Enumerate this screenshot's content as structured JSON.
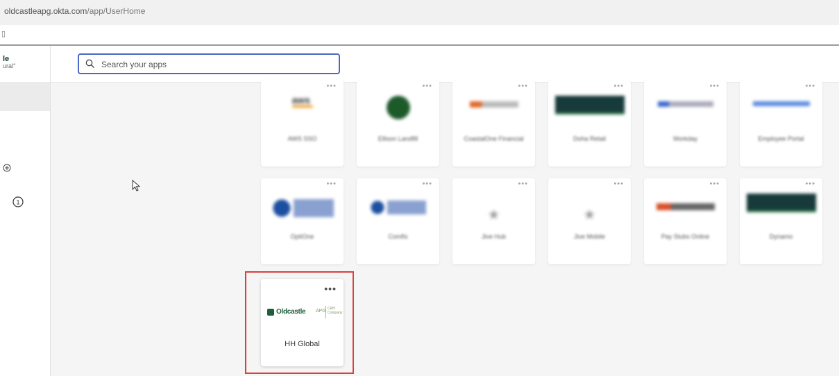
{
  "browser": {
    "url_host": "oldcastleapg.okta.com",
    "url_path": "/app/UserHome"
  },
  "sidebar": {
    "logo_line1": "le",
    "logo_line2": "ural°",
    "icons": [
      "plus-circle-icon",
      "info-circle-icon"
    ],
    "info_count": "1"
  },
  "search": {
    "placeholder": "Search your apps",
    "value": ""
  },
  "blurred_tiles_row1": [
    {
      "label": "AWS SSO",
      "logo": "aws",
      "color": "#f08c00"
    },
    {
      "label": "Ellison Landfill",
      "logo": "green-circle",
      "color": "#1d5a2a"
    },
    {
      "label": "CoastalOne Financial",
      "logo": "orange-bar",
      "color": "#e06b2a"
    },
    {
      "label": "Doha Retail",
      "logo": "dark-banner",
      "color": "#173a3a"
    },
    {
      "label": "Workday",
      "logo": "blue-text",
      "color": "#3a6bd0"
    },
    {
      "label": "Employee Portal",
      "logo": "light-blue-text",
      "color": "#5c8ce0"
    }
  ],
  "blurred_tiles_row2": [
    {
      "label": "OptiOne",
      "logo": "blue-circle",
      "color": "#1d4fa0"
    },
    {
      "label": "Comfis",
      "logo": "blue-circle-small",
      "color": "#1d4fa0"
    },
    {
      "label": "Jive Hub",
      "logo": "star",
      "color": "#9a9a9a"
    },
    {
      "label": "Jive Mobile",
      "logo": "star",
      "color": "#9a9a9a"
    },
    {
      "label": "Pay Stubs Online",
      "logo": "orange-red",
      "color": "#d8502a"
    },
    {
      "label": "Dynamo",
      "logo": "dark-banner",
      "color": "#173a3a"
    }
  ],
  "featured_tile": {
    "name": "HH Global",
    "logo_text": "Oldcastle",
    "logo_suffix": "APG",
    "logo_side_text": "CRH Company",
    "more_label": "•••",
    "highlight_color": "#d9403a"
  },
  "tile_more_label": "•••"
}
